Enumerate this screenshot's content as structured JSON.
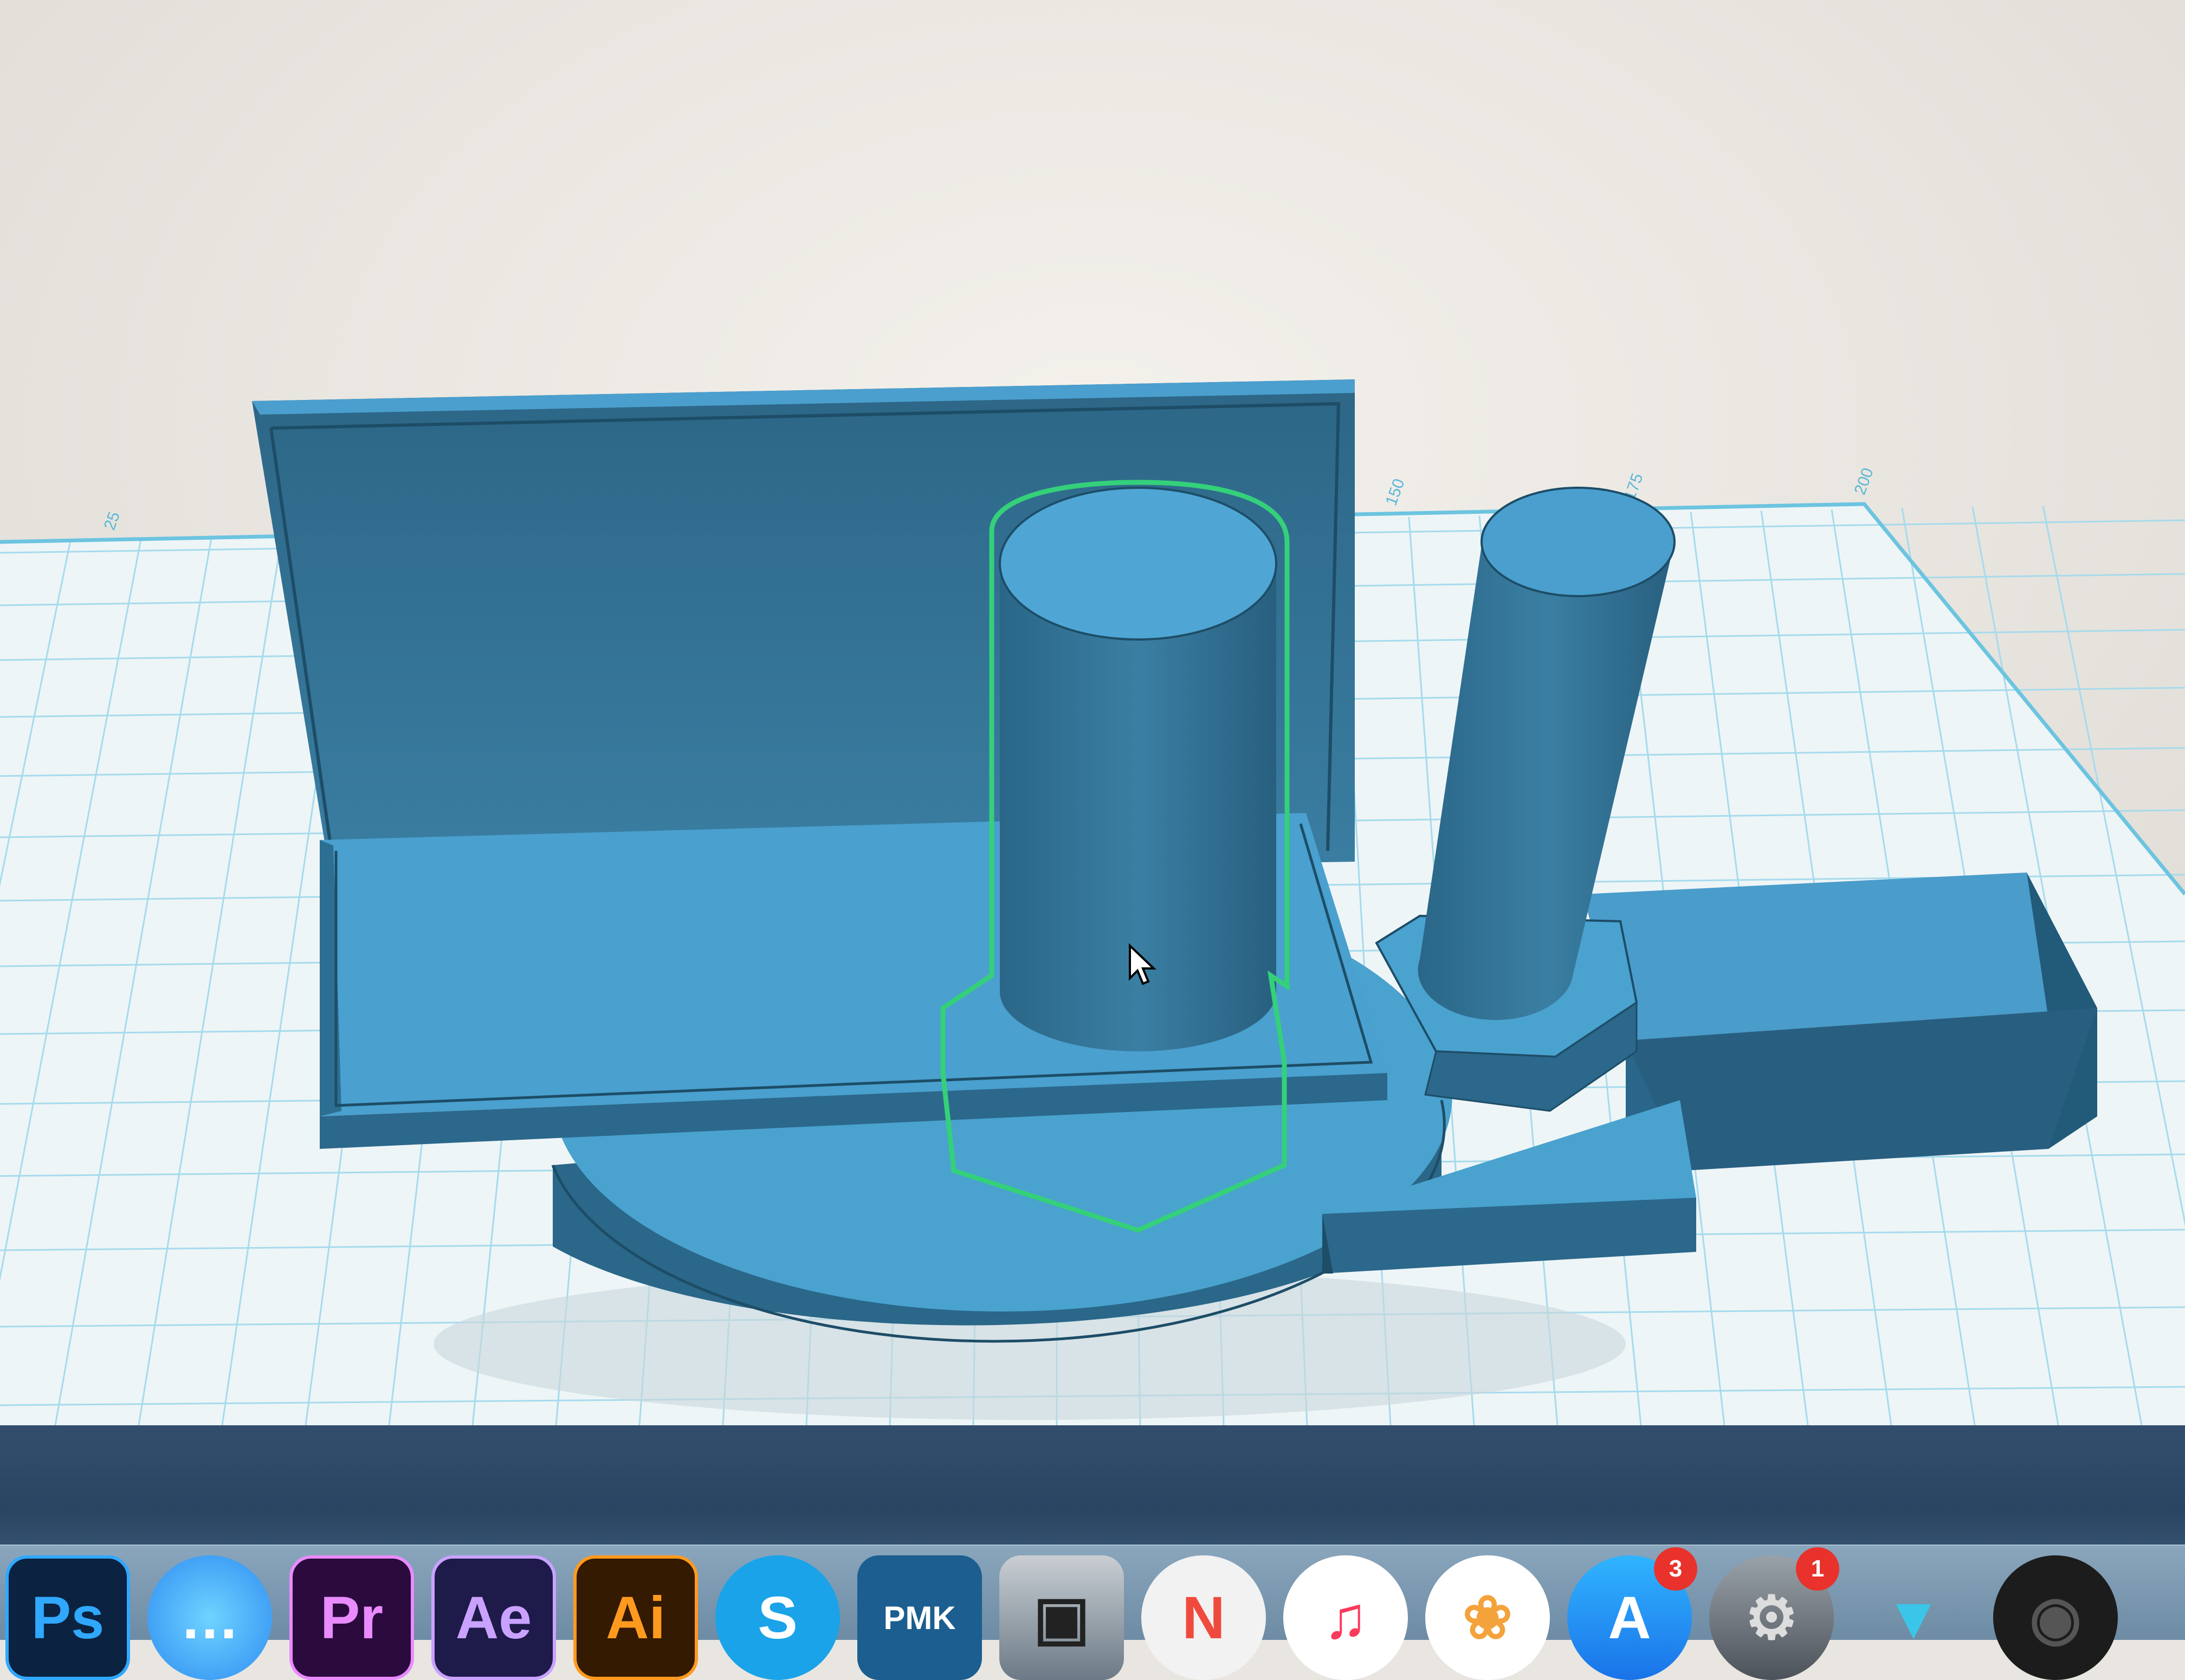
{
  "workplane": {
    "ruler_labels": [
      "25",
      "150",
      "175",
      "200"
    ]
  },
  "dock": {
    "apps": [
      {
        "name": "Photoshop",
        "label": "Ps",
        "icon": "photoshop-icon"
      },
      {
        "name": "Messages",
        "label": "",
        "icon": "messages-icon"
      },
      {
        "name": "Premiere Pro",
        "label": "Pr",
        "icon": "premiere-icon"
      },
      {
        "name": "After Effects",
        "label": "Ae",
        "icon": "after-effects-icon"
      },
      {
        "name": "Illustrator",
        "label": "Ai",
        "icon": "illustrator-icon"
      },
      {
        "name": "Skype",
        "label": "S",
        "icon": "skype-icon"
      },
      {
        "name": "PMK",
        "label": "PMK",
        "icon": "pmk-icon"
      },
      {
        "name": "Image Capture",
        "label": "",
        "icon": "image-capture-icon"
      },
      {
        "name": "News",
        "label": "",
        "icon": "news-icon"
      },
      {
        "name": "Music",
        "label": "",
        "icon": "music-icon"
      },
      {
        "name": "Photos",
        "label": "",
        "icon": "photos-icon"
      },
      {
        "name": "App Store",
        "label": "",
        "icon": "app-store-icon",
        "badge": "3"
      },
      {
        "name": "System Preferences",
        "label": "",
        "icon": "system-preferences-icon",
        "badge": "1"
      },
      {
        "name": "Vectorworks",
        "label": "",
        "icon": "triangle-app-icon"
      },
      {
        "name": "Photo Booth",
        "label": "",
        "icon": "camera-icon"
      }
    ]
  },
  "colors": {
    "model_top": "#4fa6d4",
    "model_side": "#2d6f92",
    "model_dark": "#26607f",
    "selection": "#34d07a",
    "grid_line": "#8fd0e8"
  }
}
